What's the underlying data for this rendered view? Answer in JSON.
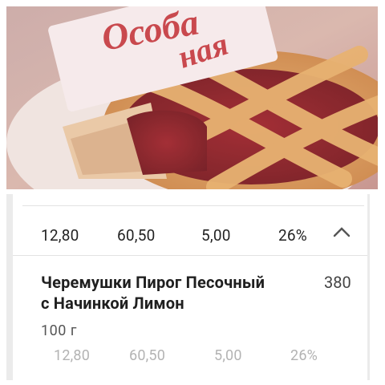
{
  "product_image": {
    "brand_text": "Особа",
    "top_text": "ная"
  },
  "summary_row": {
    "protein": "12,80",
    "carbs": "60,50",
    "fat": "5,00",
    "percent": "26%",
    "toggle_icon": "chevron-up-icon"
  },
  "product": {
    "title_line1": "Черемушки Пирог Песочный",
    "title_line2": "с Начинкой Лимон",
    "calories": "380",
    "serving": "100 г",
    "protein": "12,80",
    "carbs": "60,50",
    "fat": "5,00",
    "percent": "26%"
  },
  "colors": {
    "accent_red": "#c53a3f",
    "text_primary": "#1f1f1f",
    "text_muted": "#b3b3b3",
    "divider": "#e3e3e3"
  }
}
